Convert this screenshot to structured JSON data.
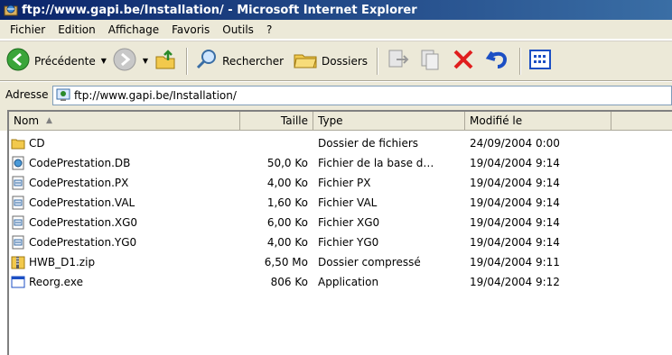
{
  "window": {
    "title": "ftp://www.gapi.be/Installation/ - Microsoft Internet Explorer"
  },
  "menu": [
    "Fichier",
    "Edition",
    "Affichage",
    "Favoris",
    "Outils",
    "?"
  ],
  "toolbar": {
    "back_label": "Précédente",
    "search_label": "Rechercher",
    "folders_label": "Dossiers"
  },
  "address": {
    "label": "Adresse",
    "value": "ftp://www.gapi.be/Installation/"
  },
  "columns": {
    "name": "Nom",
    "size": "Taille",
    "type": "Type",
    "modified": "Modifié le"
  },
  "files": [
    {
      "icon": "folder-icon",
      "name": "CD",
      "size": "",
      "type": "Dossier de fichiers",
      "modified": "24/09/2004 0:00"
    },
    {
      "icon": "database-file-icon",
      "name": "CodePrestation.DB",
      "size": "50,0 Ko",
      "type": "Fichier de la base d…",
      "modified": "19/04/2004 9:14"
    },
    {
      "icon": "generic-file-icon",
      "name": "CodePrestation.PX",
      "size": "4,00 Ko",
      "type": "Fichier PX",
      "modified": "19/04/2004 9:14"
    },
    {
      "icon": "generic-file-icon",
      "name": "CodePrestation.VAL",
      "size": "1,60 Ko",
      "type": "Fichier VAL",
      "modified": "19/04/2004 9:14"
    },
    {
      "icon": "generic-file-icon",
      "name": "CodePrestation.XG0",
      "size": "6,00 Ko",
      "type": "Fichier XG0",
      "modified": "19/04/2004 9:14"
    },
    {
      "icon": "generic-file-icon",
      "name": "CodePrestation.YG0",
      "size": "4,00 Ko",
      "type": "Fichier YG0",
      "modified": "19/04/2004 9:14"
    },
    {
      "icon": "zip-file-icon",
      "name": "HWB_D1.zip",
      "size": "6,50 Mo",
      "type": "Dossier compressé",
      "modified": "19/04/2004 9:11"
    },
    {
      "icon": "application-icon",
      "name": "Reorg.exe",
      "size": "806 Ko",
      "type": "Application",
      "modified": "19/04/2004 9:12"
    }
  ]
}
